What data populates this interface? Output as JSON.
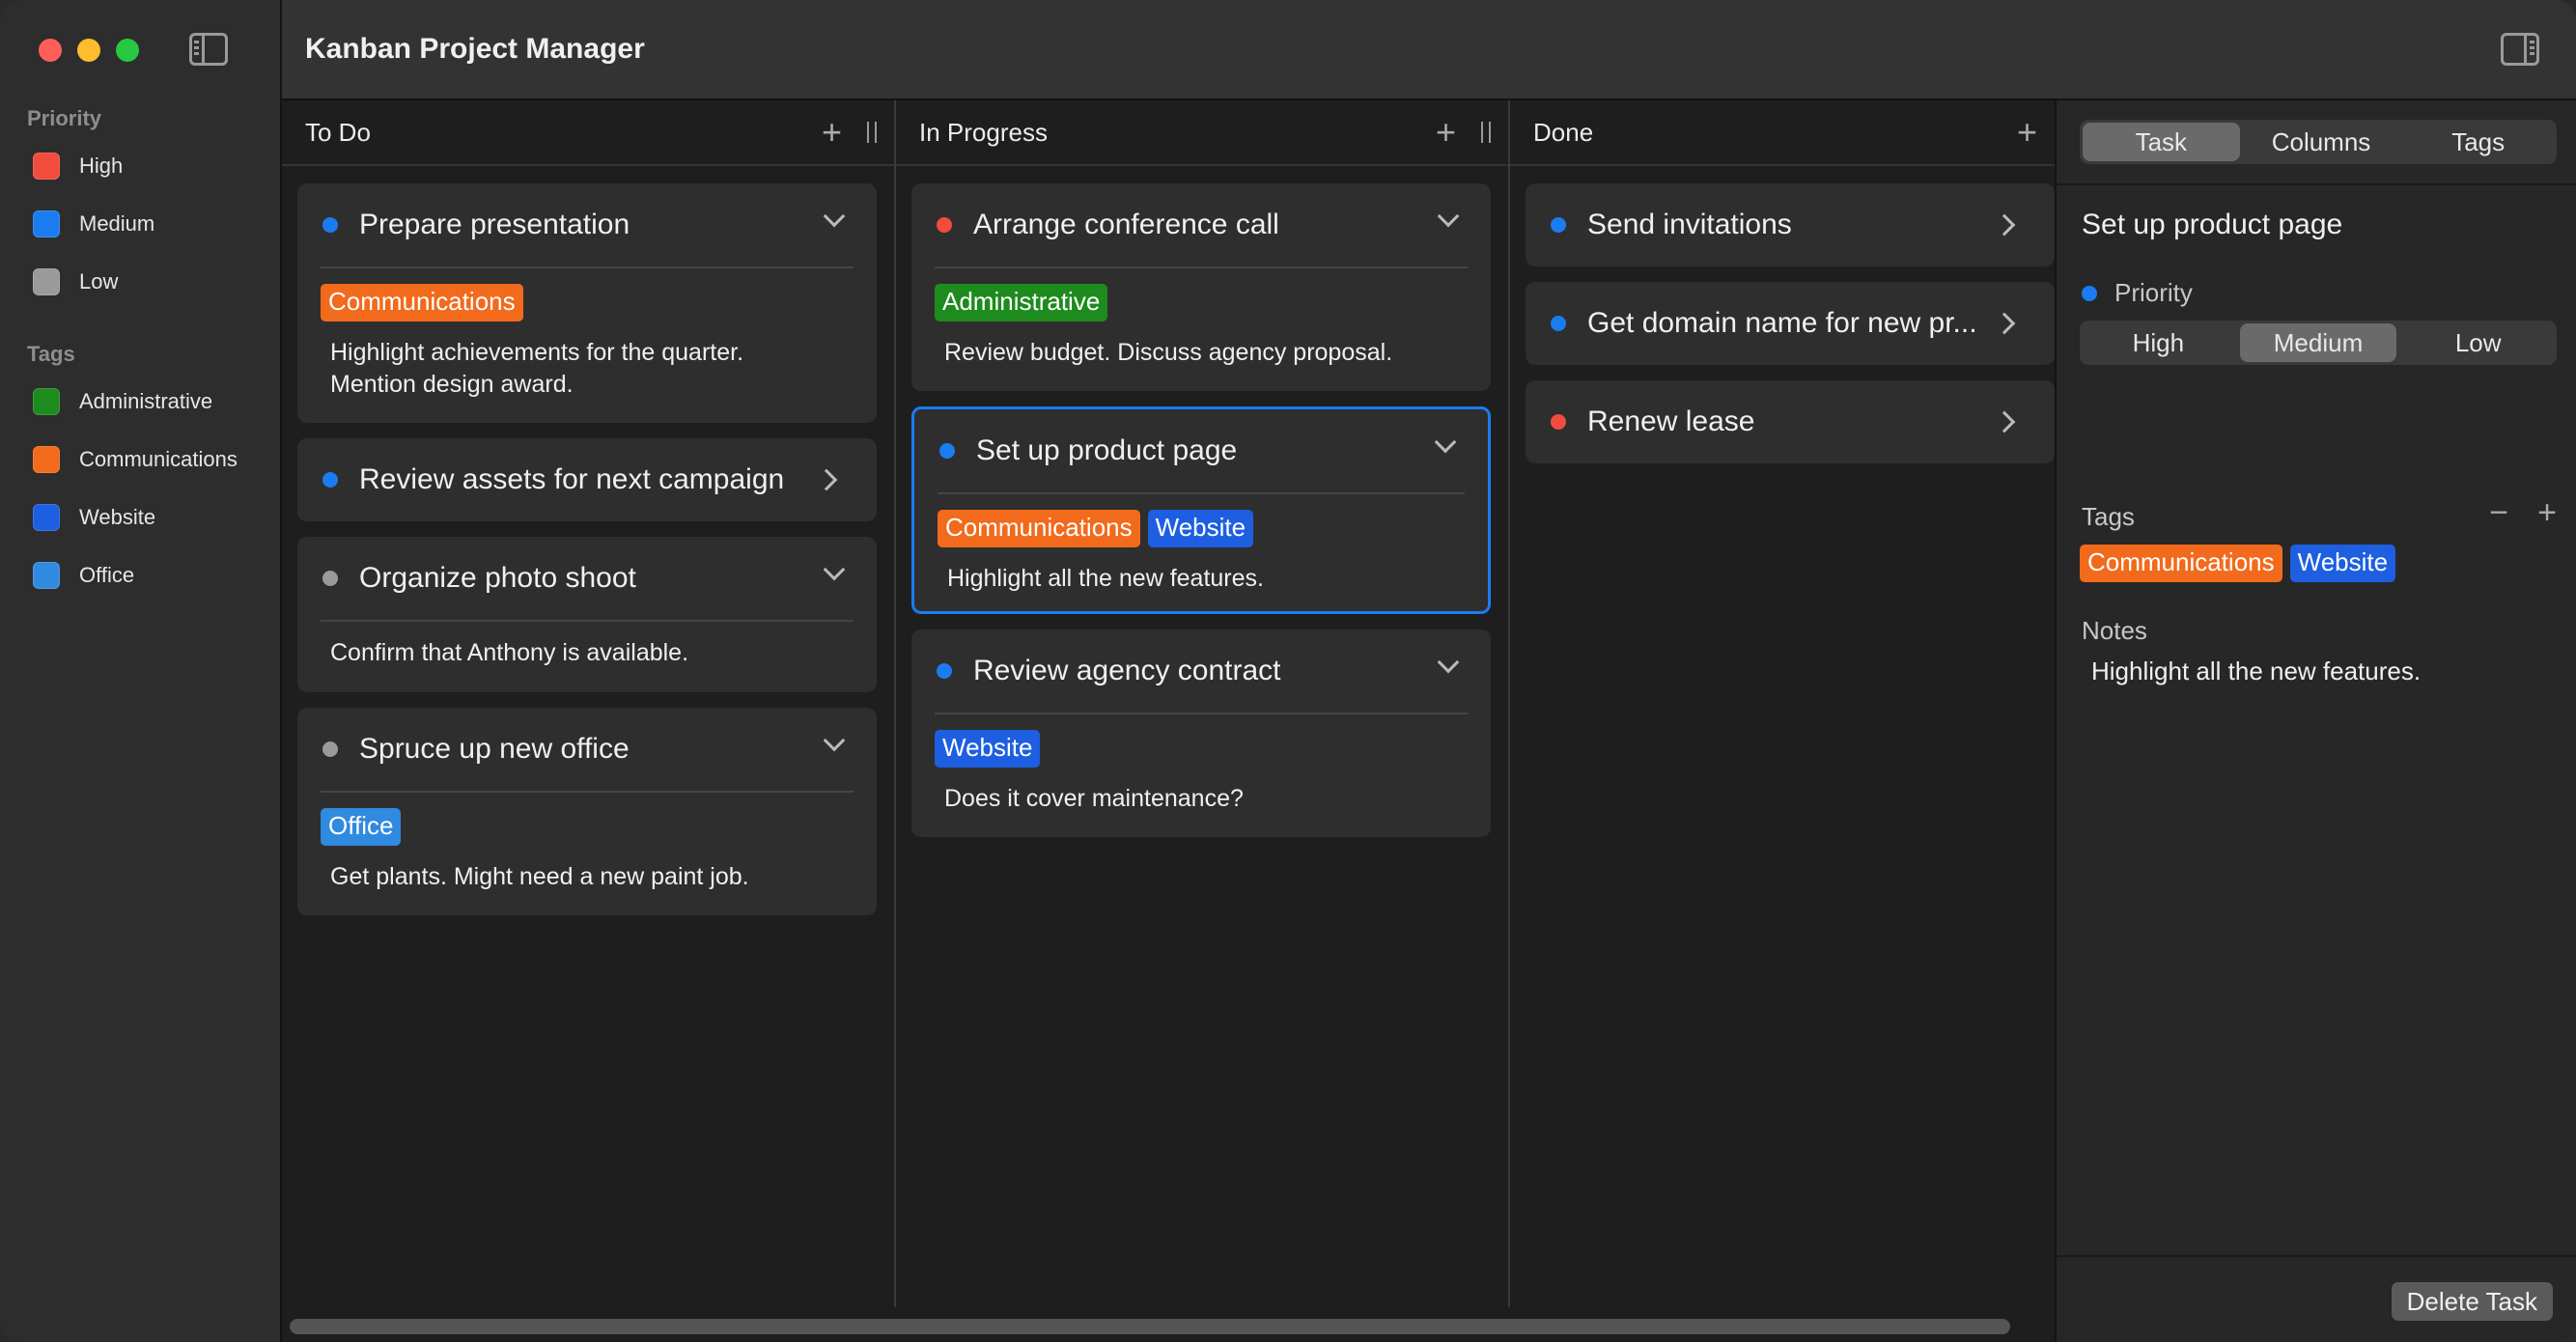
{
  "app": {
    "title": "Kanban Project Manager"
  },
  "colors": {
    "traffic_close": "#ff5f57",
    "traffic_min": "#febc2e",
    "traffic_max": "#28c840",
    "priority_high": "#f14c3e",
    "priority_medium": "#1a7cf0",
    "priority_low": "#9a9a9a",
    "tag_administrative": "#1d8b1d",
    "tag_communications": "#f26a1b",
    "tag_website": "#1d5fe0",
    "tag_office": "#2f8ae0",
    "selection": "#1a7cf0"
  },
  "sidebar": {
    "priority_title": "Priority",
    "priority_items": [
      {
        "label": "High",
        "color": "#f14c3e"
      },
      {
        "label": "Medium",
        "color": "#1a7cf0"
      },
      {
        "label": "Low",
        "color": "#9a9a9a"
      }
    ],
    "tags_title": "Tags",
    "tag_items": [
      {
        "label": "Administrative",
        "color": "#1d8b1d"
      },
      {
        "label": "Communications",
        "color": "#f26a1b"
      },
      {
        "label": "Website",
        "color": "#1d5fe0"
      },
      {
        "label": "Office",
        "color": "#2f8ae0"
      }
    ]
  },
  "columns": [
    {
      "title": "To Do",
      "cards": [
        {
          "title": "Prepare presentation",
          "priority_color": "#1a7cf0",
          "expanded": true,
          "tags": [
            {
              "label": "Communications",
              "color": "#f26a1b"
            }
          ],
          "notes_lines": [
            "Highlight achievements for the quarter.",
            "Mention design award."
          ]
        },
        {
          "title": "Review assets for next campaign",
          "priority_color": "#1a7cf0",
          "expanded": false
        },
        {
          "title": "Organize photo shoot",
          "priority_color": "#9a9a9a",
          "expanded": true,
          "tags": [],
          "notes_lines": [
            "Confirm that Anthony is available."
          ]
        },
        {
          "title": "Spruce up new office",
          "priority_color": "#9a9a9a",
          "expanded": true,
          "tags": [
            {
              "label": "Office",
              "color": "#2f8ae0"
            }
          ],
          "notes_lines": [
            "Get plants. Might need a new paint job."
          ]
        }
      ]
    },
    {
      "title": "In Progress",
      "cards": [
        {
          "title": "Arrange conference call",
          "priority_color": "#f14c3e",
          "expanded": true,
          "tags": [
            {
              "label": "Administrative",
              "color": "#1d8b1d"
            }
          ],
          "notes_lines": [
            "Review budget. Discuss agency proposal."
          ]
        },
        {
          "title": "Set up product page",
          "priority_color": "#1a7cf0",
          "expanded": true,
          "selected": true,
          "tags": [
            {
              "label": "Communications",
              "color": "#f26a1b"
            },
            {
              "label": "Website",
              "color": "#1d5fe0"
            }
          ],
          "notes_lines": [
            "Highlight all the new features."
          ]
        },
        {
          "title": "Review agency contract",
          "priority_color": "#1a7cf0",
          "expanded": true,
          "tags": [
            {
              "label": "Website",
              "color": "#1d5fe0"
            }
          ],
          "notes_lines": [
            "Does it cover maintenance?"
          ]
        }
      ]
    },
    {
      "title": "Done",
      "cards": [
        {
          "title": "Send invitations",
          "priority_color": "#1a7cf0",
          "expanded": false
        },
        {
          "title": "Get domain name for new pr...",
          "priority_color": "#1a7cf0",
          "expanded": false
        },
        {
          "title": "Renew lease",
          "priority_color": "#f14c3e",
          "expanded": false
        }
      ]
    }
  ],
  "inspector": {
    "tabs": [
      "Task",
      "Columns",
      "Tags"
    ],
    "active_tab": "Task",
    "task_title": "Set up product page",
    "priority_label": "Priority",
    "priority_options": [
      "High",
      "Medium",
      "Low"
    ],
    "priority_selected": "Medium",
    "tags_label": "Tags",
    "tags": [
      {
        "label": "Communications",
        "color": "#f26a1b"
      },
      {
        "label": "Website",
        "color": "#1d5fe0"
      }
    ],
    "notes_label": "Notes",
    "notes": "Highlight all the new features.",
    "delete_label": "Delete Task"
  }
}
